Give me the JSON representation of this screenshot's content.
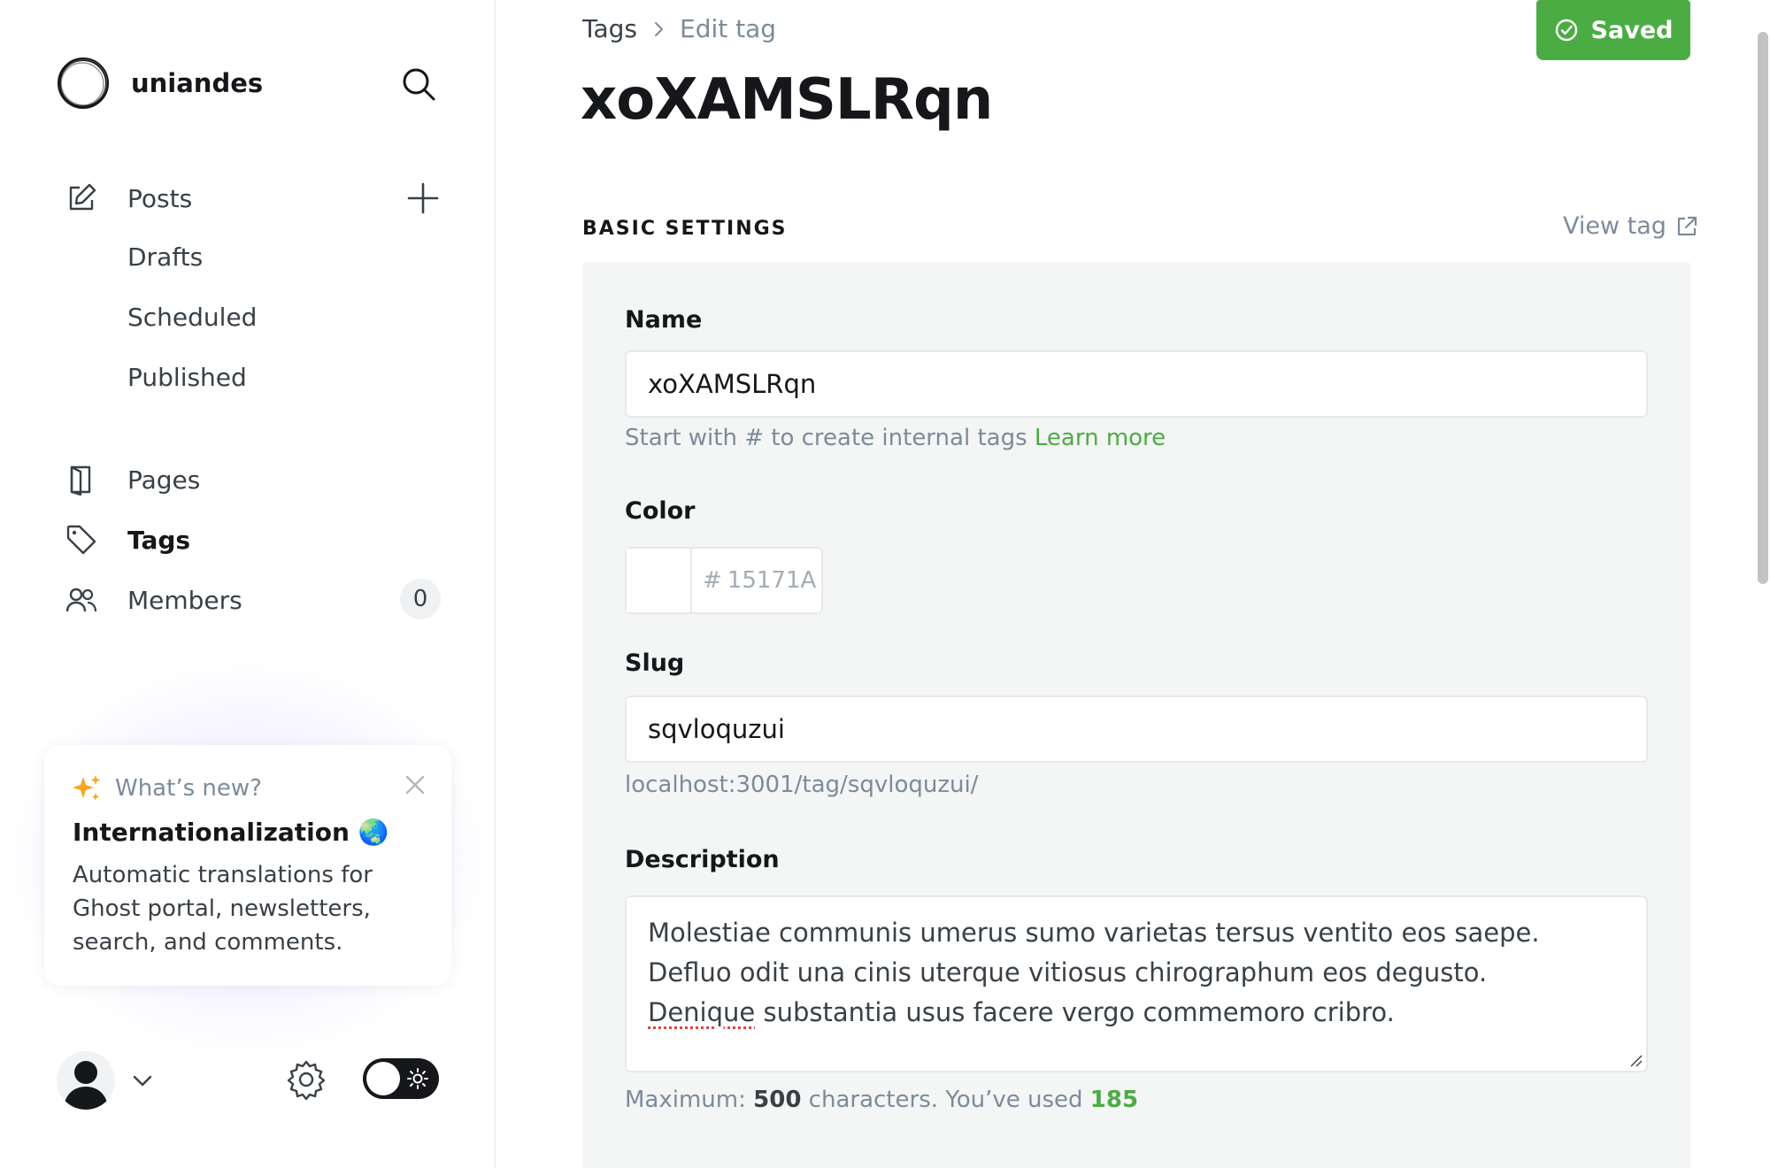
{
  "sidebar": {
    "brand_name": "uniandes",
    "nav": {
      "posts": "Posts",
      "drafts": "Drafts",
      "scheduled": "Scheduled",
      "published": "Published",
      "pages": "Pages",
      "tags": "Tags",
      "members": "Members",
      "members_count": "0"
    },
    "whats_new": {
      "kicker": "What’s new?",
      "title": "Internationalization 🌏",
      "body": "Automatic translations for Ghost portal, newsletters, search, and comments."
    }
  },
  "header": {
    "breadcrumb_parent": "Tags",
    "breadcrumb_current": "Edit tag",
    "title": "xoXAMSLRqn",
    "saved_label": "Saved"
  },
  "form": {
    "section_title": "BASIC SETTINGS",
    "view_tag": "View tag",
    "name_label": "Name",
    "name_value": "xoXAMSLRqn",
    "name_hint": "Start with # to create internal tags",
    "learn_more": "Learn more",
    "color_label": "Color",
    "color_hash": "#",
    "color_placeholder": "15171A",
    "slug_label": "Slug",
    "slug_value": "sqvloquzui",
    "slug_url": "localhost:3001/tag/sqvloquzui/",
    "description_label": "Description",
    "description_line1": "Molestiae communis umerus sumo varietas tersus ventito eos saepe.",
    "description_line2": "Defluo odit una cinis uterque vitiosus chirographum eos degusto.",
    "description_line3_word": "Denique",
    "description_line3_rest": " substantia usus facere vergo commemoro cribro.",
    "max_prefix": "Maximum: ",
    "max_value": "500",
    "max_mid": " characters. You’ve used ",
    "used_value": "185"
  },
  "colors": {
    "accent_green": "#4cac44",
    "text_dark": "#15171a",
    "text_muted": "#7c8b9a",
    "panel_bg": "#f4f5f5"
  }
}
